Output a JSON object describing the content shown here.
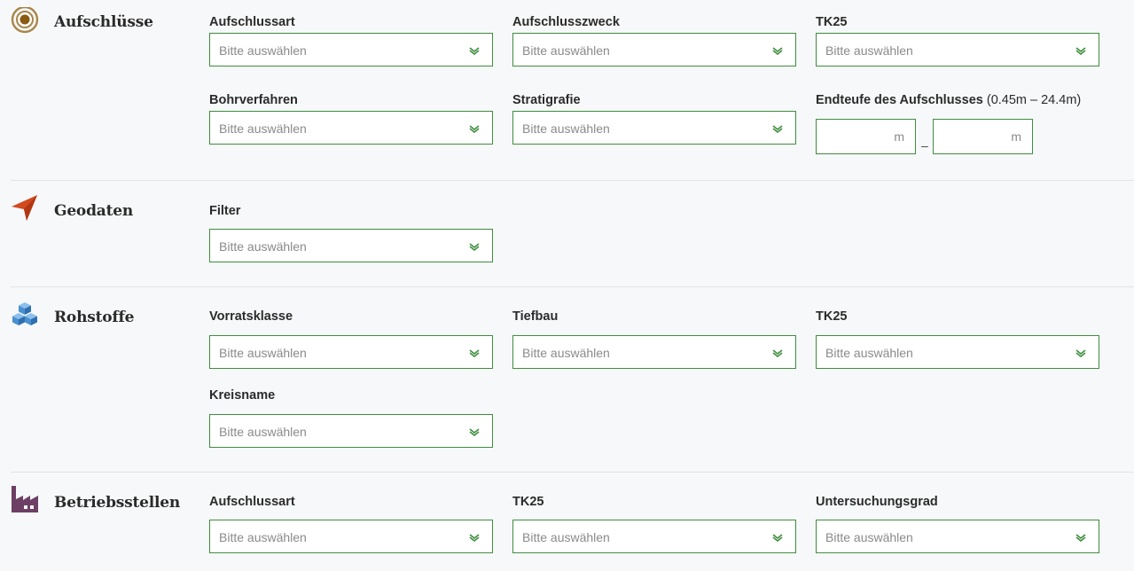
{
  "placeholder": "Bitte auswählen",
  "sections": {
    "aufschluesse": {
      "title": "Aufschlüsse",
      "fields": {
        "aufschlussart": "Aufschlussart",
        "aufschlusszweck": "Aufschlusszweck",
        "tk25": "TK25",
        "bohrverfahren": "Bohrverfahren",
        "stratigrafie": "Stratigrafie",
        "endteufe": "Endteufe des Aufschlusses",
        "endteufe_range": "(0.45m – 24.4m)",
        "unit": "m",
        "range_dash": "–"
      }
    },
    "geodaten": {
      "title": "Geodaten",
      "fields": {
        "filter": "Filter"
      }
    },
    "rohstoffe": {
      "title": "Rohstoffe",
      "fields": {
        "vorratsklasse": "Vorratsklasse",
        "tiefbau": "Tiefbau",
        "tk25": "TK25",
        "kreisname": "Kreisname"
      }
    },
    "betriebsstellen": {
      "title": "Betriebsstellen",
      "fields": {
        "aufschlussart": "Aufschlussart",
        "tk25": "TK25",
        "untersuchungsgrad": "Untersuchungsgrad"
      }
    }
  },
  "colors": {
    "accent_border": "#3e8e3e",
    "chevron": "#3e8e3e",
    "aufschluesse_icon": "#a8864a",
    "geodaten_icon": "#d24a1e",
    "rohstoffe_icon": "#2f7fc8",
    "betriebsstellen_icon": "#6d3f64"
  },
  "icons": {
    "aufschluesse": "target-circle-icon",
    "geodaten": "navigation-arrow-icon",
    "rohstoffe": "stacked-cubes-icon",
    "betriebsstellen": "factory-icon",
    "dropdown": "double-chevron-down-icon"
  }
}
